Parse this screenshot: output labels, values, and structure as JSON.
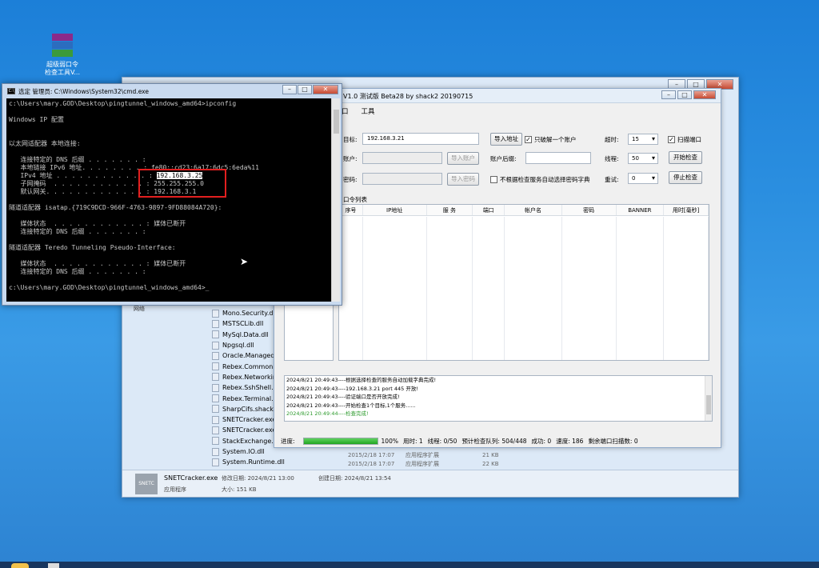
{
  "desktop": {
    "icon_label_line1": "超级弱口令",
    "icon_label_line2": "检查工具V..."
  },
  "explorer": {
    "nav_partial": "网络",
    "files": [
      "Mono.Security.dll",
      "MSTSCLib.dll",
      "MySql.Data.dll",
      "Npgsql.dll",
      "Oracle.Managed",
      "Rebex.Common.",
      "Rebex.Networkir",
      "Rebex.SshShell.d",
      "Rebex.Terminal.c",
      "SharpCifs.shack2",
      "SNETCracker.exe",
      "SNETCracker.exe",
      "StackExchange.R",
      "System.IO.dll",
      "System.Runtime.dll"
    ],
    "details": [
      {
        "date": "2015/2/18 17:07",
        "type": "应用程序扩展",
        "size": "21 KB"
      },
      {
        "date": "2015/2/18 17:07",
        "type": "应用程序扩展",
        "size": "22 KB"
      }
    ],
    "status": {
      "thumb_text": "SNETC",
      "name": "SNETCracker.exe",
      "type": "应用程序",
      "modified": "修改日期: 2024/8/21 13:00",
      "created": "创建日期: 2024/8/21 13:54",
      "size": "大小: 151 KB"
    }
  },
  "cracker": {
    "title": "V1.0 测试版 Beta28 by shack2 20190715",
    "menu": [
      "口",
      "工具"
    ],
    "target_label": "目标:",
    "target_value": "192.168.3.21",
    "import_addr_btn": "导入地址",
    "only_first_label": "只破解一个账户",
    "timeout_label": "超时:",
    "timeout_value": "15",
    "scan_port_label": "扫描端口",
    "account_label": "账户:",
    "import_account_btn": "导入账户",
    "account_suffix_label": "账户后缀:",
    "threads_label": "线程:",
    "threads_value": "50",
    "start_btn": "开始检查",
    "password_label": "密码:",
    "import_password_btn": "导入密码",
    "no_auto_dict_label": "不根据检查服务自动选择密码字典",
    "retry_label": "重试:",
    "retry_value": "0",
    "stop_btn": "停止检查",
    "list_label": "口令列表",
    "columns": [
      "序号",
      "IP地址",
      "服 务",
      "端口",
      "帐户名",
      "密码",
      "BANNER",
      "用时[毫秒]"
    ],
    "log": [
      {
        "text": "2024/8/21 20:49:43----根据选择检查的服务自动加载字典完成!",
        "color": "#000000"
      },
      {
        "text": "2024/8/21 20:49:43----192.168.3.21 port 445 开放!",
        "color": "#000000"
      },
      {
        "text": "2024/8/21 20:49:43----验证端口是否开放完成!",
        "color": "#000000"
      },
      {
        "text": "2024/8/21 20:49:43----开始检查1个目标,1个服务......",
        "color": "#000000"
      },
      {
        "text": "2024/8/21 20:49:44----检查完成!",
        "color": "#2e9b2e"
      }
    ],
    "status": {
      "progress_label": "进度:",
      "progress_fraction": 1.0,
      "progress_text": "100%",
      "elapsed": "用时: 1",
      "threads": "线程: 0/50",
      "queue": "预计检查队列: 504/448",
      "success": "成功: 0",
      "speed": "速度: 186",
      "remaining": "剩余端口扫描数: 0"
    }
  },
  "cmd": {
    "title": "选定 管理员: C:\\Windows\\System32\\cmd.exe",
    "lines": [
      "c:\\Users\\mary.GOD\\Desktop\\pingtunnel_windows_amd64>ipconfig",
      "",
      "Windows IP 配置",
      "",
      "",
      "以太网适配器 本地连接:",
      "",
      "   连接特定的 DNS 后缀 . . . . . . . :",
      "   本地链接 IPv6 地址. . . . . . . . : fe80::cd23:6a17:6dc5:6eda%11",
      "   IPv4 地址 . . . . . . . . . . . . : 192.168.3.25",
      "   子网掩码  . . . . . . . . . . . . : 255.255.255.0",
      "   默认网关. . . . . . . . . . . . . : 192.168.3.1",
      "",
      "隧道适配器 isatap.{719C9DCD-966F-4763-9897-9FD88084A720}:",
      "",
      "   媒体状态  . . . . . . . . . . . . : 媒体已断开",
      "   连接特定的 DNS 后缀 . . . . . . . :",
      "",
      "隧道适配器 Teredo Tunneling Pseudo-Interface:",
      "",
      "   媒体状态  . . . . . . . . . . . . : 媒体已断开",
      "   连接特定的 DNS 后缀 . . . . . . . :",
      "",
      "c:\\Users\\mary.GOD\\Desktop\\pingtunnel_windows_amd64>_"
    ],
    "highlighted_line_index": 9,
    "highlight_color": "#e21f1f"
  }
}
